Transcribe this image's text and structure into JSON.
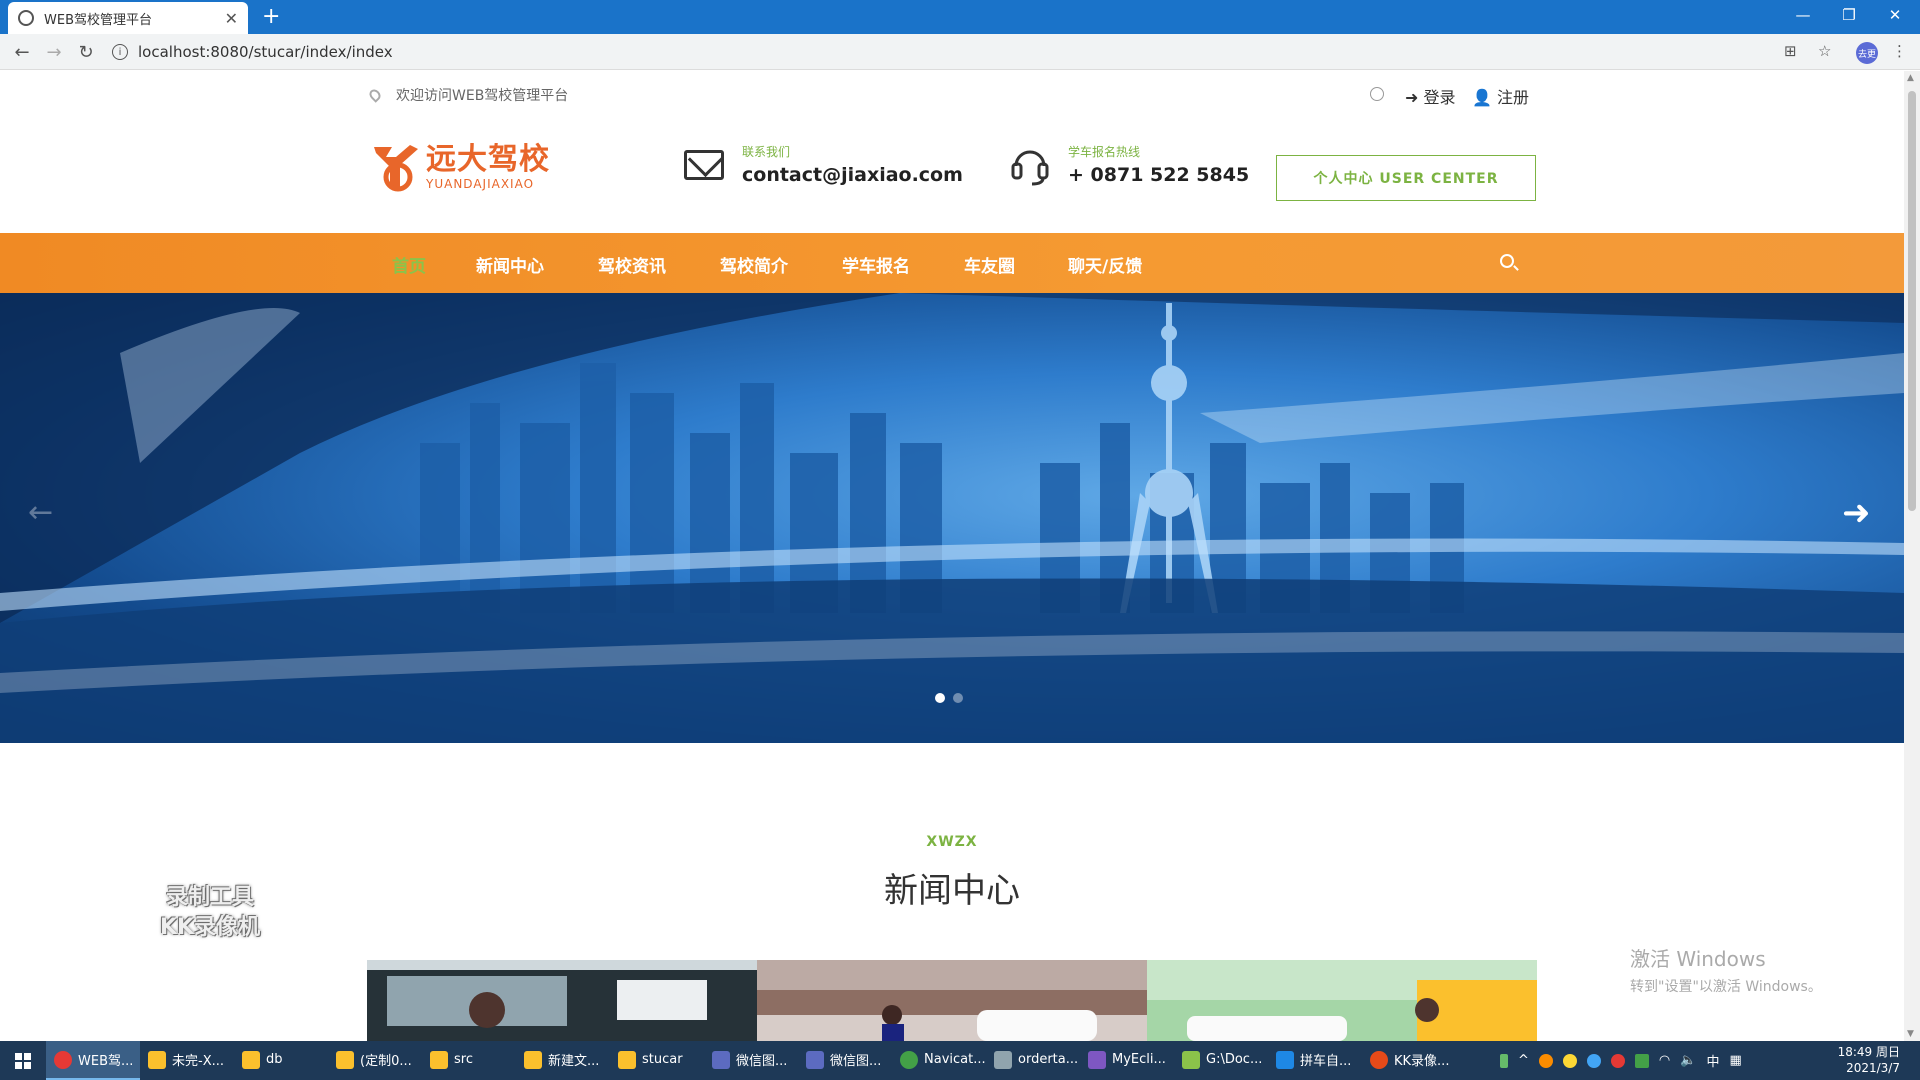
{
  "browser": {
    "tab_title": "WEB驾校管理平台",
    "url": "localhost:8080/stucar/index/index",
    "profile_label": "去更"
  },
  "topbar": {
    "welcome": "欢迎访问WEB驾校管理平台",
    "login": "登录",
    "register": "注册"
  },
  "header": {
    "logo_cn": "远大驾校",
    "logo_en": "YUANDAJIAXIAO",
    "contact_label": "联系我们",
    "contact_email": "contact@jiaxiao.com",
    "hotline_label": "学车报名热线",
    "hotline": "+ 0871 522 5845",
    "user_center": "个人中心 USER CENTER"
  },
  "nav": {
    "items": [
      "首页",
      "新闻中心",
      "驾校资讯",
      "驾校简介",
      "学车报名",
      "车友圈",
      "聊天/反馈"
    ],
    "active_index": 0
  },
  "banner": {
    "slide_count": 2,
    "active_slide": 0
  },
  "section": {
    "subtitle": "XWZX",
    "title": "新闻中心"
  },
  "overlay": {
    "watermark_line1": "录制工具",
    "watermark_line2": "KK录像机",
    "activate_title": "激活 Windows",
    "activate_sub": "转到\"设置\"以激活 Windows。"
  },
  "taskbar": {
    "tasks": [
      "WEB驾...",
      "未完-X...",
      "db",
      "(定制0...",
      "src",
      "新建文...",
      "stucar",
      "微信图...",
      "微信图...",
      "Navicat...",
      "orderta...",
      "MyEcli...",
      "G:\\Doc...",
      "拼车自...",
      "KK录像..."
    ],
    "tray_ime": "中",
    "time": "18:49 周日",
    "date": "2021/3/7"
  },
  "colors": {
    "accent_orange": "#f08a24",
    "accent_green": "#7cb342",
    "logo_orange": "#e8662a",
    "chrome_blue": "#1a73c9",
    "taskbar": "#1e3957"
  }
}
